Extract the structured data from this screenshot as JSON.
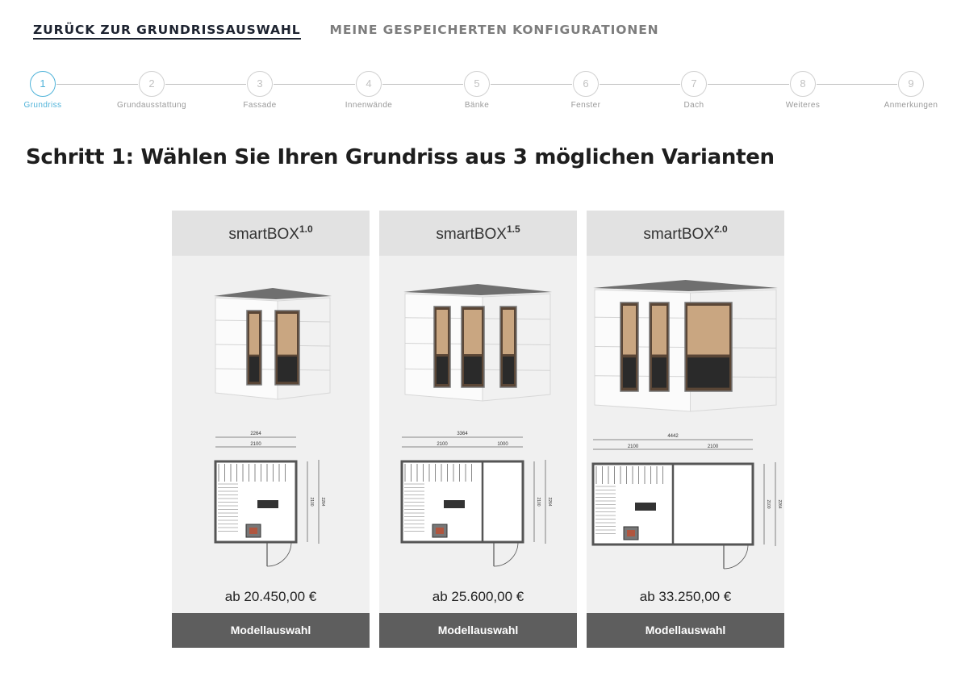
{
  "nav": {
    "back_label": "ZURÜCK ZUR GRUNDRISSAUSWAHL",
    "saved_label": "MEINE GESPEICHERTEN KONFIGURATIONEN"
  },
  "steps": [
    {
      "num": "1",
      "label": "Grundriss"
    },
    {
      "num": "2",
      "label": "Grundausstattung"
    },
    {
      "num": "3",
      "label": "Fassade"
    },
    {
      "num": "4",
      "label": "Innenwände"
    },
    {
      "num": "5",
      "label": "Bänke"
    },
    {
      "num": "6",
      "label": "Fenster"
    },
    {
      "num": "7",
      "label": "Dach"
    },
    {
      "num": "8",
      "label": "Weiteres"
    },
    {
      "num": "9",
      "label": "Anmerkungen"
    }
  ],
  "active_step": "1",
  "heading": "Schritt 1: Wählen Sie Ihren Grundriss aus 3 möglichen Varianten",
  "models": [
    {
      "name": "smartBOX",
      "version": "1.0",
      "price": "ab 20.450,00 €",
      "button": "Modellauswahl",
      "plan": {
        "total_width": "2264",
        "inner_widths": [
          "2100"
        ],
        "depth_inner": "2100",
        "depth_total": "2264"
      }
    },
    {
      "name": "smartBOX",
      "version": "1.5",
      "price": "ab 25.600,00 €",
      "button": "Modellauswahl",
      "plan": {
        "total_width": "3364",
        "inner_widths": [
          "2100",
          "1000"
        ],
        "depth_inner": "2100",
        "depth_total": "2264"
      }
    },
    {
      "name": "smartBOX",
      "version": "2.0",
      "price": "ab 33.250,00 €",
      "button": "Modellauswahl",
      "plan": {
        "total_width": "4442",
        "inner_widths": [
          "2100",
          "2100"
        ],
        "depth_inner": "2100",
        "depth_total": "2264"
      }
    }
  ],
  "colors": {
    "active_step": "#4fb3d9",
    "button_bg": "#5e5e5e",
    "card_bg": "#f0f0f0",
    "card_header_bg": "#e2e2e2"
  }
}
